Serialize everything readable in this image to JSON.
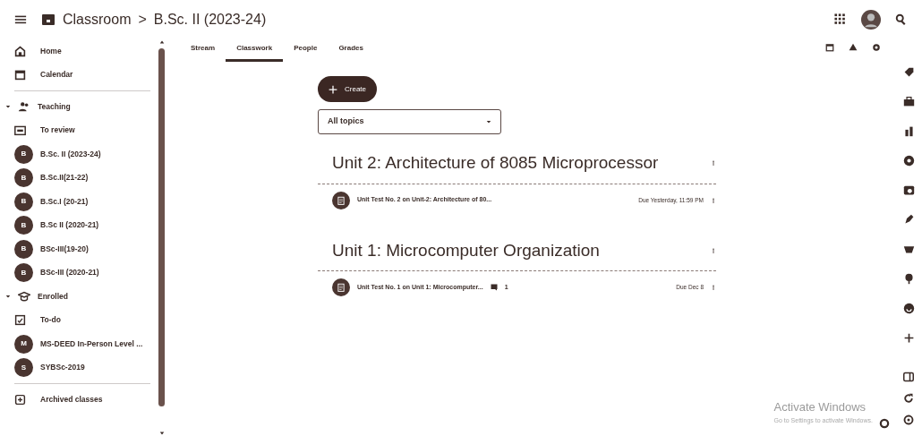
{
  "header": {
    "app": "Classroom",
    "separator": ">",
    "course": "B.Sc. II (2023-24)"
  },
  "sidebar": {
    "items": [
      {
        "kind": "link",
        "label": "Home"
      },
      {
        "kind": "link",
        "label": "Calendar"
      },
      {
        "kind": "divider"
      },
      {
        "kind": "section",
        "label": "Teaching",
        "expanded": true
      },
      {
        "kind": "link",
        "label": "To review"
      },
      {
        "kind": "class",
        "letter": "B",
        "label": "B.Sc. II (2023-24)"
      },
      {
        "kind": "class",
        "letter": "B",
        "label": "B.Sc.II(21-22)"
      },
      {
        "kind": "class",
        "letter": "B",
        "label": "B.Sc.I (20-21)"
      },
      {
        "kind": "class",
        "letter": "B",
        "label": "B.Sc II (2020-21)"
      },
      {
        "kind": "class",
        "letter": "B",
        "label": "BSc-III(19-20)"
      },
      {
        "kind": "class",
        "letter": "B",
        "label": "BSc-III (2020-21)"
      },
      {
        "kind": "section",
        "label": "Enrolled",
        "expanded": true
      },
      {
        "kind": "link",
        "label": "To-do"
      },
      {
        "kind": "class",
        "letter": "M",
        "label": "MS-DEED In-Person Level ..."
      },
      {
        "kind": "class",
        "letter": "S",
        "label": "SYBSc-2019"
      },
      {
        "kind": "divider"
      },
      {
        "kind": "link",
        "label": "Archived classes"
      }
    ]
  },
  "tabs": [
    {
      "label": "Stream",
      "selected": false
    },
    {
      "label": "Classwork",
      "selected": true
    },
    {
      "label": "People",
      "selected": false
    },
    {
      "label": "Grades",
      "selected": false
    }
  ],
  "create_button": {
    "label": "Create"
  },
  "topic_filter": {
    "value": "All topics"
  },
  "topics": [
    {
      "title": "Unit 2: Architecture of 8085 Microprocessor",
      "items": [
        {
          "title": "Unit Test No. 2 on Unit-2: Architecture of 80...",
          "due": "Due Yesterday, 11:59 PM"
        }
      ]
    },
    {
      "title": "Unit 1: Microcomputer Organization",
      "items": [
        {
          "title": "Unit Test No. 1 on Unit 1: Microcomputer...",
          "comments": "1",
          "due": "Due Dec 8"
        }
      ]
    }
  ],
  "activation_notice": {
    "title": "Activate Windows",
    "subtitle": "Go to Settings to activate Windows."
  }
}
